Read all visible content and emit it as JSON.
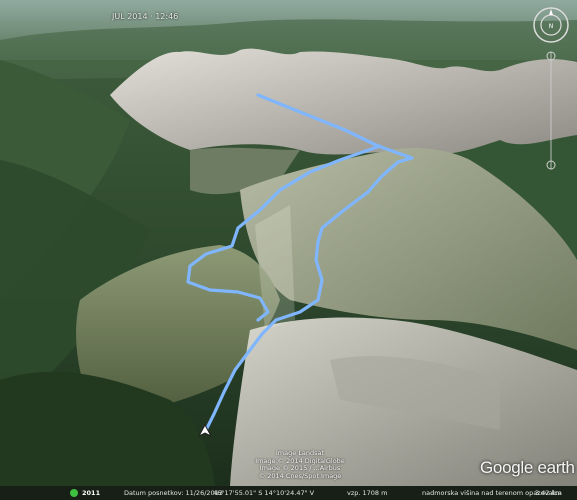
{
  "map": {
    "timestamp": "JUL 2014 · 12:46",
    "attribution": [
      "Image Landsat",
      "Image © 2014 DigitalGlobe",
      "Image © 2015 / ...Airbus",
      "© 2014 Cnes/Spot Image"
    ],
    "logo_text": "Google earth",
    "status_year": "2011",
    "status_date": "Datum posnetkov: 11/26/2013",
    "status_coords": "46°17'55.01\" S   14°10'24.47\" V",
    "status_elev": "vzp. 1708 m",
    "status_eye": "nadmorska višina nad terenom opazovalca",
    "status_alt": "3.42 km",
    "route_color": "#7fb6ff",
    "icons": [
      "compass-icon",
      "zoom-slider-icon",
      "tour-icon",
      "placemark-icon"
    ]
  }
}
